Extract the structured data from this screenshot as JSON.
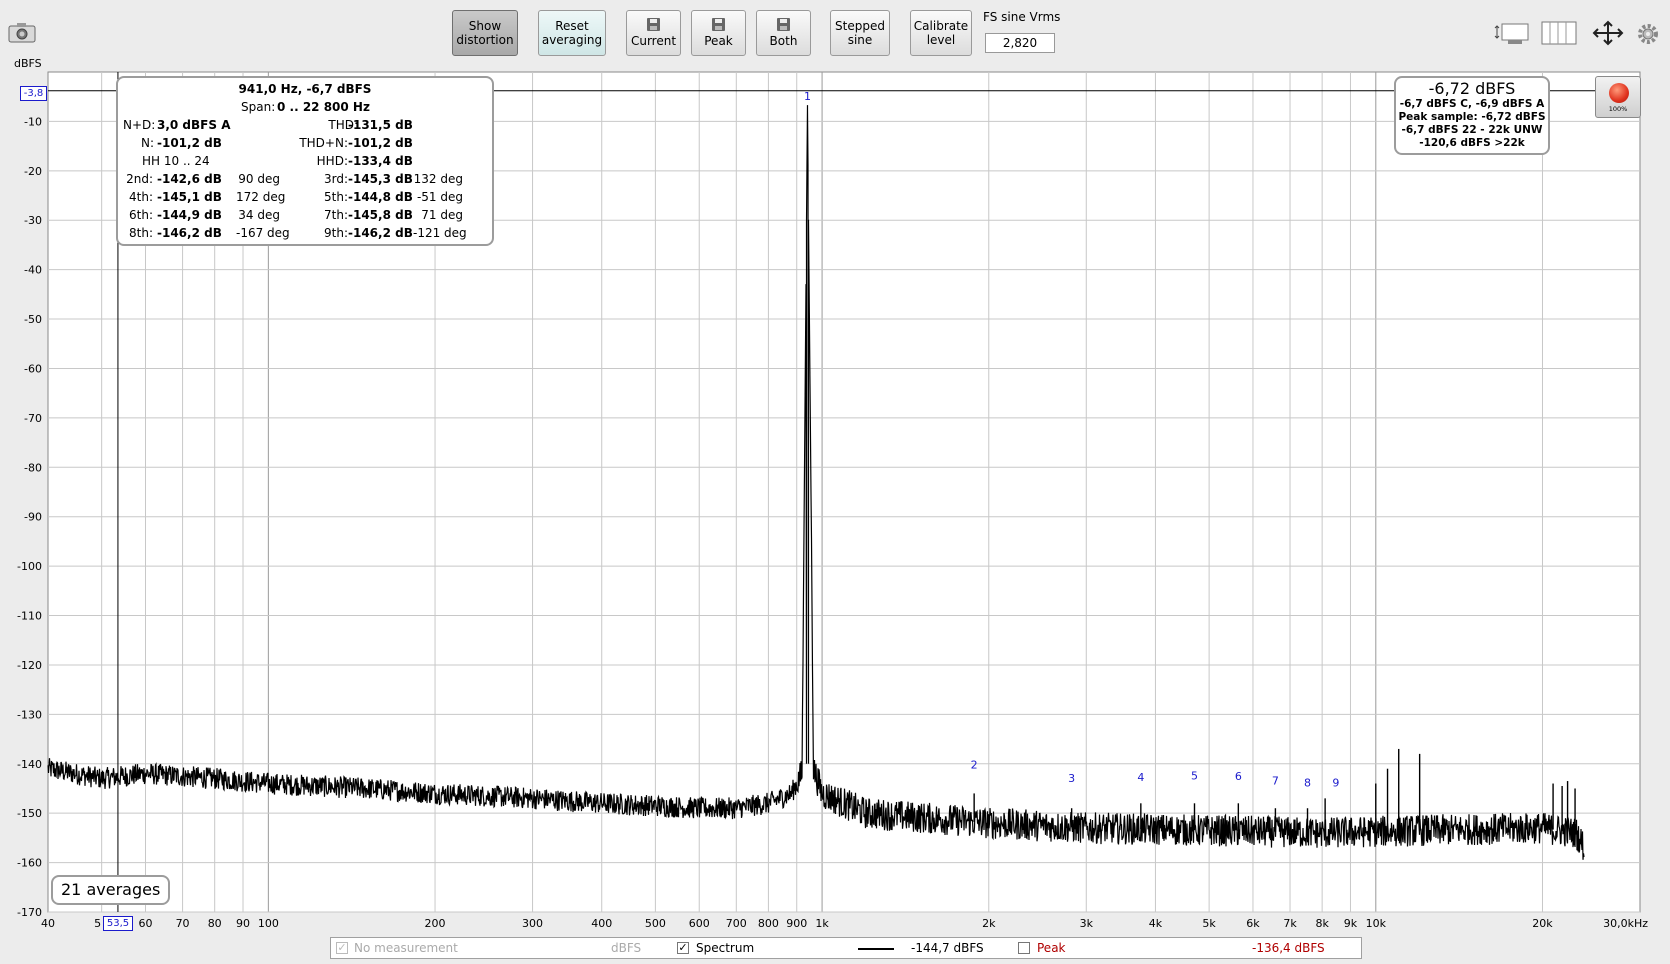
{
  "toolbar": {
    "show_distortion_line1": "Show",
    "show_distortion_line2": "distortion",
    "reset_averaging_line1": "Reset",
    "reset_averaging_line2": "averaging",
    "save_current": "Current",
    "save_peak": "Peak",
    "save_both": "Both",
    "stepped_sine_line1": "Stepped",
    "stepped_sine_line2": "sine",
    "calibrate_line1": "Calibrate",
    "calibrate_line2": "level",
    "fs_label": "FS sine Vrms",
    "fs_value": "2,820"
  },
  "axis": {
    "y_unit": "dBFS",
    "cursor_y_label": "-3,8",
    "cursor_x_label": "53,5"
  },
  "info_box": {
    "title": "941,0 Hz, -6,7 dBFS",
    "span_label": "Span:",
    "span_value": "0 .. 22 800 Hz",
    "nd_label": "N+D:",
    "nd_value": "3,0 dBFS A",
    "thd_label": "THD:",
    "thd_value": "-131,5 dB",
    "n_label": "N:",
    "n_value": "-101,2 dB",
    "thdn_label": "THD+N:",
    "thdn_value": "-101,2 dB",
    "hh_label": "HH 10 .. 24",
    "hhd_label": "HHD:",
    "hhd_value": "-133,4 dB",
    "harmonics": [
      {
        "l1": "2nd:",
        "v1": "-142,6 dB",
        "p1": "90 deg",
        "l2": "3rd:",
        "v2": "-145,3 dB",
        "p2": "132 deg"
      },
      {
        "l1": "4th:",
        "v1": "-145,1 dB",
        "p1": "172 deg",
        "l2": "5th:",
        "v2": "-144,8 dB",
        "p2": "-51 deg"
      },
      {
        "l1": "6th:",
        "v1": "-144,9 dB",
        "p1": "34 deg",
        "l2": "7th:",
        "v2": "-145,8 dB",
        "p2": "71 deg"
      },
      {
        "l1": "8th:",
        "v1": "-146,2 dB",
        "p1": "-167 deg",
        "l2": "9th:",
        "v2": "-146,2 dB",
        "p2": "-121 deg"
      }
    ]
  },
  "level_box": {
    "main": "-6,72 dBFS",
    "line1": "-6,7 dBFS C, -6,9 dBFS A",
    "line2": "Peak sample: -6,72 dBFS",
    "line3": "-6,7 dBFS 22 - 22k UNW",
    "line4": "-120,6 dBFS >22k"
  },
  "record_button": {
    "label": "100%"
  },
  "averages": "21 averages",
  "legend": {
    "no_measurement": "No measurement",
    "no_measurement_unit": "dBFS",
    "spectrum": "Spectrum",
    "spectrum_value": "-144,7 dBFS",
    "peak": "Peak",
    "peak_value": "-136,4 dBFS"
  },
  "colors": {
    "trace": "#000000",
    "grid": "#c8c8c8",
    "marker": "#1a1acc",
    "peak_text": "#b00000",
    "record": "#e0321e"
  },
  "chart_data": {
    "type": "line",
    "x_scale": "log",
    "xlim": [
      40,
      30000
    ],
    "ylim": [
      -170,
      0
    ],
    "ylabel": "dBFS",
    "x_tick_labels": [
      {
        "v": 40,
        "t": "40"
      },
      {
        "v": 50,
        "t": "5"
      },
      {
        "v": 60,
        "t": "60"
      },
      {
        "v": 70,
        "t": "70"
      },
      {
        "v": 80,
        "t": "80"
      },
      {
        "v": 90,
        "t": "90"
      },
      {
        "v": 100,
        "t": "100"
      },
      {
        "v": 200,
        "t": "200"
      },
      {
        "v": 300,
        "t": "300"
      },
      {
        "v": 400,
        "t": "400"
      },
      {
        "v": 500,
        "t": "500"
      },
      {
        "v": 600,
        "t": "600"
      },
      {
        "v": 700,
        "t": "700"
      },
      {
        "v": 800,
        "t": "800"
      },
      {
        "v": 900,
        "t": "900"
      },
      {
        "v": 1000,
        "t": "1k"
      },
      {
        "v": 2000,
        "t": "2k"
      },
      {
        "v": 3000,
        "t": "3k"
      },
      {
        "v": 4000,
        "t": "4k"
      },
      {
        "v": 5000,
        "t": "5k"
      },
      {
        "v": 6000,
        "t": "6k"
      },
      {
        "v": 7000,
        "t": "7k"
      },
      {
        "v": 8000,
        "t": "8k"
      },
      {
        "v": 9000,
        "t": "9k"
      },
      {
        "v": 10000,
        "t": "10k"
      },
      {
        "v": 20000,
        "t": "20k"
      },
      {
        "v": 30000,
        "t": "30,0kHz"
      }
    ],
    "y_tick_labels": [
      {
        "v": -10,
        "t": "-10"
      },
      {
        "v": -20,
        "t": "-20"
      },
      {
        "v": -30,
        "t": "-30"
      },
      {
        "v": -40,
        "t": "-40"
      },
      {
        "v": -50,
        "t": "-50"
      },
      {
        "v": -60,
        "t": "-60"
      },
      {
        "v": -70,
        "t": "-70"
      },
      {
        "v": -80,
        "t": "-80"
      },
      {
        "v": -90,
        "t": "-90"
      },
      {
        "v": -100,
        "t": "-100"
      },
      {
        "v": -110,
        "t": "-110"
      },
      {
        "v": -120,
        "t": "-120"
      },
      {
        "v": -130,
        "t": "-130"
      },
      {
        "v": -140,
        "t": "-140"
      },
      {
        "v": -150,
        "t": "-150"
      },
      {
        "v": -160,
        "t": "-160"
      },
      {
        "v": -170,
        "t": "-170"
      }
    ],
    "cursor": {
      "x": 53.5,
      "y": -3.8
    },
    "noise_floor": [
      {
        "x": 40,
        "y": -141
      },
      {
        "x": 50,
        "y": -143
      },
      {
        "x": 60,
        "y": -142
      },
      {
        "x": 80,
        "y": -143
      },
      {
        "x": 100,
        "y": -144
      },
      {
        "x": 150,
        "y": -145
      },
      {
        "x": 200,
        "y": -146
      },
      {
        "x": 300,
        "y": -147
      },
      {
        "x": 400,
        "y": -148
      },
      {
        "x": 500,
        "y": -148.5
      },
      {
        "x": 600,
        "y": -149
      },
      {
        "x": 700,
        "y": -149
      },
      {
        "x": 800,
        "y": -148
      },
      {
        "x": 880,
        "y": -146
      },
      {
        "x": 920,
        "y": -142
      },
      {
        "x": 941,
        "y": -6.7
      },
      {
        "x": 965,
        "y": -141
      },
      {
        "x": 1000,
        "y": -146
      },
      {
        "x": 1200,
        "y": -150
      },
      {
        "x": 2000,
        "y": -152
      },
      {
        "x": 3000,
        "y": -153
      },
      {
        "x": 5000,
        "y": -153.5
      },
      {
        "x": 8000,
        "y": -154
      },
      {
        "x": 12000,
        "y": -153.5
      },
      {
        "x": 20000,
        "y": -153
      },
      {
        "x": 23000,
        "y": -154
      },
      {
        "x": 23800,
        "y": -157
      }
    ],
    "spurs": [
      {
        "x": 1882,
        "y": -146
      },
      {
        "x": 2823,
        "y": -149
      },
      {
        "x": 3764,
        "y": -148
      },
      {
        "x": 4705,
        "y": -148
      },
      {
        "x": 5646,
        "y": -148
      },
      {
        "x": 6587,
        "y": -149
      },
      {
        "x": 7528,
        "y": -149
      },
      {
        "x": 8100,
        "y": -147
      },
      {
        "x": 9999,
        "y": -144
      },
      {
        "x": 10500,
        "y": -141
      },
      {
        "x": 11000,
        "y": -137
      },
      {
        "x": 12000,
        "y": -138
      },
      {
        "x": 20900,
        "y": -144
      },
      {
        "x": 21700,
        "y": -144.5
      },
      {
        "x": 22200,
        "y": -143.5
      },
      {
        "x": 22900,
        "y": -145
      }
    ],
    "harmonic_markers": [
      {
        "n": "1",
        "x": 941,
        "y": -6.7
      },
      {
        "n": "2",
        "x": 1882,
        "y": -142.6
      },
      {
        "n": "3",
        "x": 2823,
        "y": -145.3
      },
      {
        "n": "4",
        "x": 3764,
        "y": -145.1
      },
      {
        "n": "5",
        "x": 4705,
        "y": -144.8
      },
      {
        "n": "6",
        "x": 5646,
        "y": -144.9
      },
      {
        "n": "7",
        "x": 6587,
        "y": -145.8
      },
      {
        "n": "8",
        "x": 7528,
        "y": -146.2
      },
      {
        "n": "9",
        "x": 8469,
        "y": -146.2
      }
    ]
  }
}
